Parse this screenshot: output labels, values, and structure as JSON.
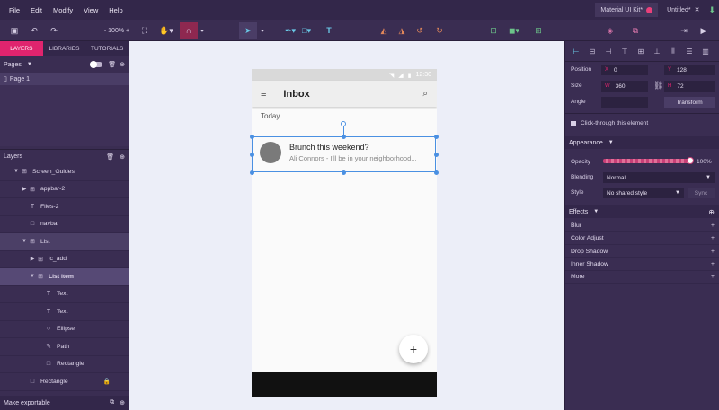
{
  "menu": [
    "File",
    "Edit",
    "Modify",
    "View",
    "Help"
  ],
  "tabs": [
    {
      "label": "Material UI Kit*",
      "active": true
    },
    {
      "label": "Untitled*",
      "active": false
    }
  ],
  "toolbar": {
    "zoom": "100%"
  },
  "left_tabs": [
    "LAYERS",
    "LIBRARIES",
    "TUTORIALS"
  ],
  "pages_label": "Pages",
  "pages": [
    "Page 1"
  ],
  "layers_label": "Layers",
  "layers": [
    {
      "label": "Screen_Guides",
      "indent": 0,
      "arrow": "▼",
      "icon": "symbol-icon",
      "glyph": "⊞",
      "hl": ""
    },
    {
      "label": "appbar-2",
      "indent": 1,
      "arrow": "▶",
      "icon": "symbol-icon",
      "glyph": "⊞",
      "hl": ""
    },
    {
      "label": "Files-2",
      "indent": 1,
      "arrow": "",
      "icon": "text-icon",
      "glyph": "T",
      "hl": ""
    },
    {
      "label": "navbar",
      "indent": 1,
      "arrow": "",
      "icon": "rectangle-icon",
      "glyph": "□",
      "hl": ""
    },
    {
      "label": "List",
      "indent": 1,
      "arrow": "▼",
      "icon": "symbol-icon",
      "glyph": "⊞",
      "hl": "hl"
    },
    {
      "label": "ic_add",
      "indent": 2,
      "arrow": "▶",
      "icon": "symbol-icon",
      "glyph": "⊞",
      "hl": ""
    },
    {
      "label": "List item",
      "indent": 2,
      "arrow": "▼",
      "icon": "symbol-icon",
      "glyph": "⊞",
      "hl": "hl2"
    },
    {
      "label": "Text",
      "indent": 3,
      "arrow": "",
      "icon": "text-icon",
      "glyph": "T",
      "hl": ""
    },
    {
      "label": "Text",
      "indent": 3,
      "arrow": "",
      "icon": "text-icon",
      "glyph": "T",
      "hl": ""
    },
    {
      "label": "Ellipse",
      "indent": 3,
      "arrow": "",
      "icon": "ellipse-icon",
      "glyph": "○",
      "hl": ""
    },
    {
      "label": "Path",
      "indent": 3,
      "arrow": "",
      "icon": "path-icon",
      "glyph": "✎",
      "hl": ""
    },
    {
      "label": "Rectangle",
      "indent": 3,
      "arrow": "",
      "icon": "rectangle-icon",
      "glyph": "□",
      "hl": ""
    },
    {
      "label": "Rectangle",
      "indent": 1,
      "arrow": "",
      "icon": "rectangle-icon",
      "glyph": "□",
      "hl": "",
      "locked": true
    }
  ],
  "make_exportable": "Make exportable",
  "phone": {
    "time": "12:30",
    "appbar_title": "Inbox",
    "subheader": "Today",
    "item_title": "Brunch this weekend?",
    "item_subtitle": "Ali Connors  -  I'll be in your neighborhood...",
    "fab": "+"
  },
  "props": {
    "position_label": "Position",
    "size_label": "Size",
    "angle_label": "Angle",
    "x": "0",
    "y": "128",
    "w": "360",
    "h": "72",
    "x_label": "X",
    "y_label": "Y",
    "w_label": "W",
    "h_label": "H",
    "transform": "Transform",
    "clickthrough": "Click-through this element"
  },
  "appearance": {
    "label": "Appearance",
    "opacity_label": "Opacity",
    "opacity": "100%",
    "blending_label": "Blending",
    "blending": "Normal",
    "style_label": "Style",
    "style": "No shared style",
    "sync": "Sync"
  },
  "effects": {
    "label": "Effects",
    "items": [
      "Blur",
      "Color Adjust",
      "Drop Shadow",
      "Inner Shadow",
      "More"
    ]
  }
}
